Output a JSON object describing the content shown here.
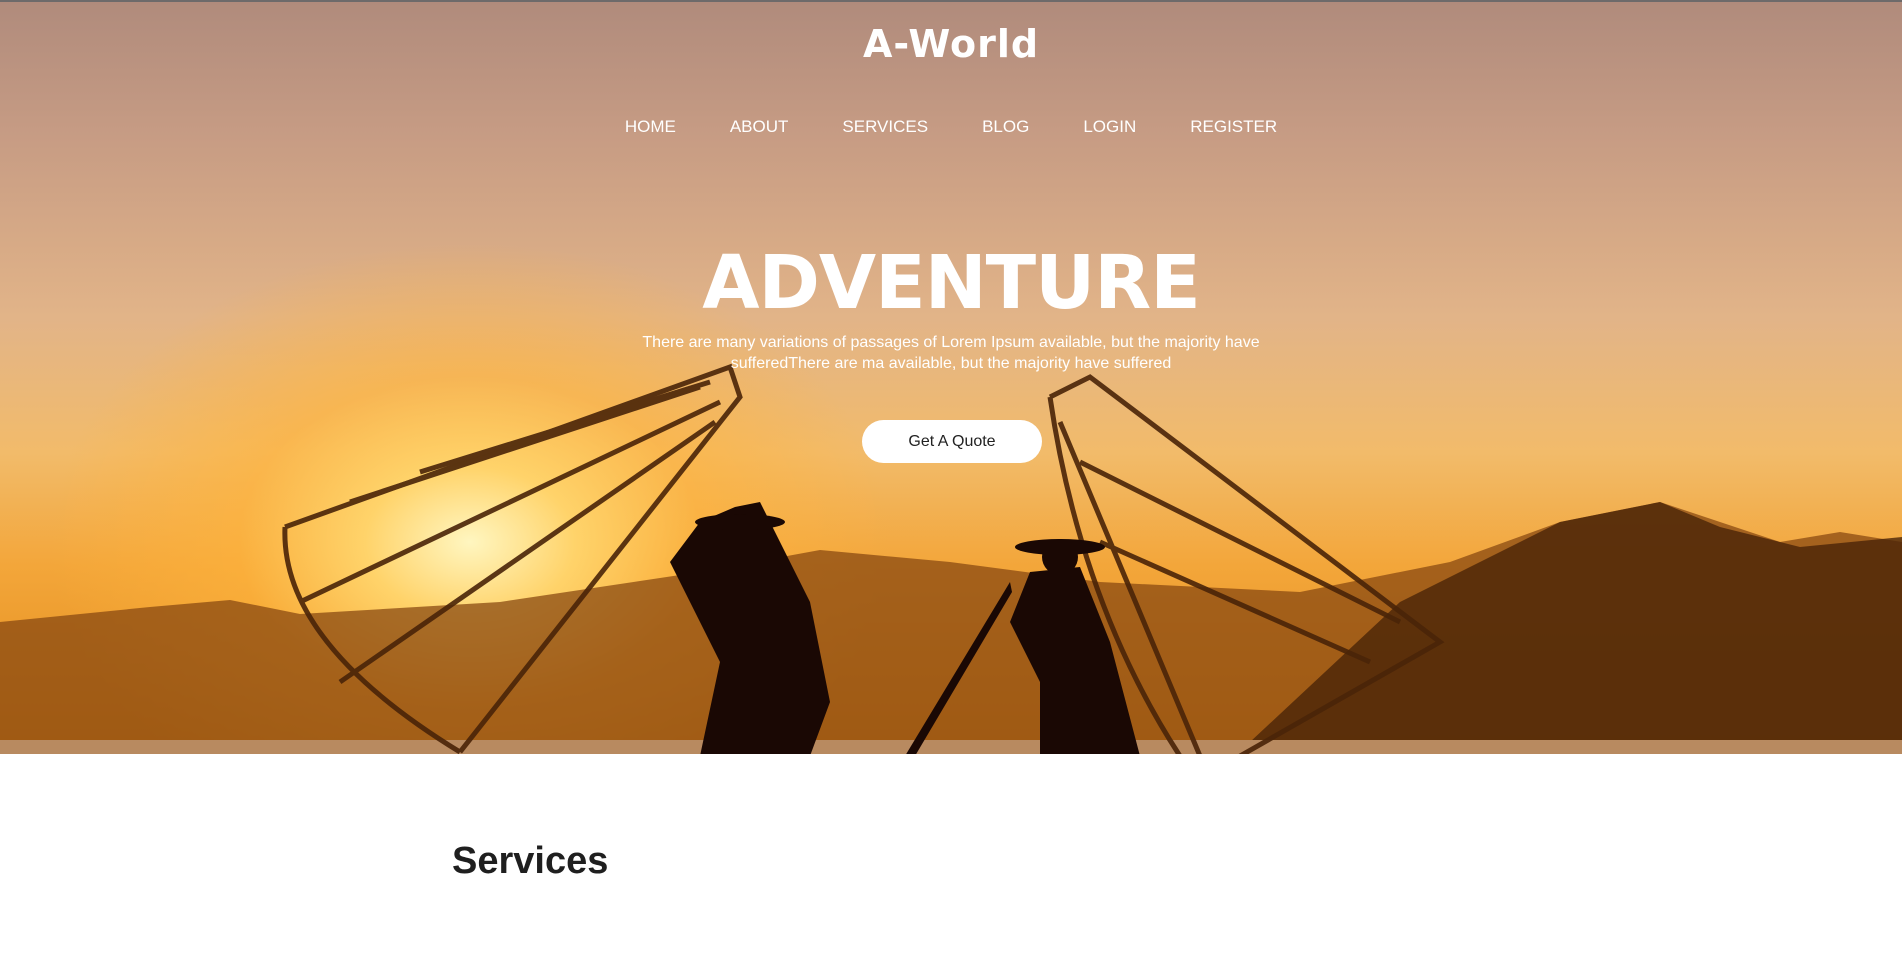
{
  "header": {
    "logo": "A-World"
  },
  "nav": {
    "items": [
      {
        "label": "HOME"
      },
      {
        "label": "ABOUT"
      },
      {
        "label": "SERVICES"
      },
      {
        "label": "BLOG"
      },
      {
        "label": "LOGIN"
      },
      {
        "label": "REGISTER"
      }
    ]
  },
  "hero": {
    "title": "ADVENTURE",
    "description": "There are many variations of passages of Lorem Ipsum available, but the majority have sufferedThere are ma available, but the majority have suffered",
    "cta_label": "Get A Quote"
  },
  "sections": {
    "services_heading": "Services"
  },
  "colors": {
    "text_dark": "#1f1f1f",
    "button_bg": "#ffffff",
    "sunset_orange": "#f3a63a"
  }
}
